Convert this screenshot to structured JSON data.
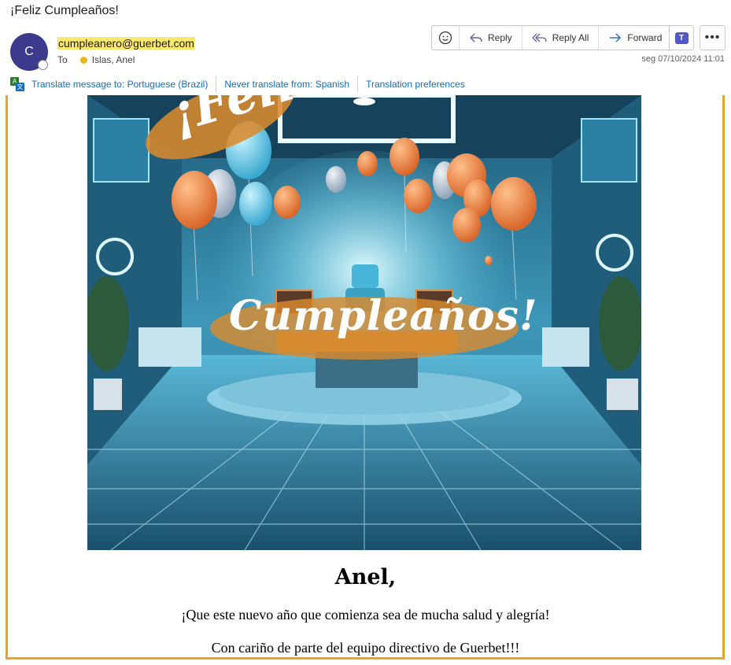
{
  "email": {
    "subject": "¡Feliz Cumpleaños!",
    "avatar_initial": "C",
    "sender": "cumpleanero@guerbet.com",
    "to_label": "To",
    "recipient": "Islas, Anel",
    "date": "seg 07/10/2024 11:01"
  },
  "actions": {
    "reply": "Reply",
    "reply_all": "Reply All",
    "forward": "Forward",
    "emoji_icon": "smiley-icon",
    "teams_icon": "teams-icon",
    "more_icon": "more-icon"
  },
  "translation": {
    "translate_to": "Translate message to: Portuguese (Brazil)",
    "never_translate": "Never translate from: Spanish",
    "preferences": "Translation preferences"
  },
  "hero": {
    "headline_top": "¡Feliz",
    "headline_main": "Cumpleaños!"
  },
  "body": {
    "name_line": "Anel,",
    "wish": "¡Que este nuevo año que comienza sea de mucha salud y alegría!",
    "signoff": "Con cariño de parte del equipo directivo de Guerbet!!!"
  },
  "colors": {
    "accent_border": "#e8a427",
    "avatar_bg": "#3b3a8c",
    "sender_highlight": "#fce86b",
    "link_blue": "#0f6cbd",
    "balloon_orange": "#e7823f",
    "balloon_blue": "#5fc7e8"
  }
}
